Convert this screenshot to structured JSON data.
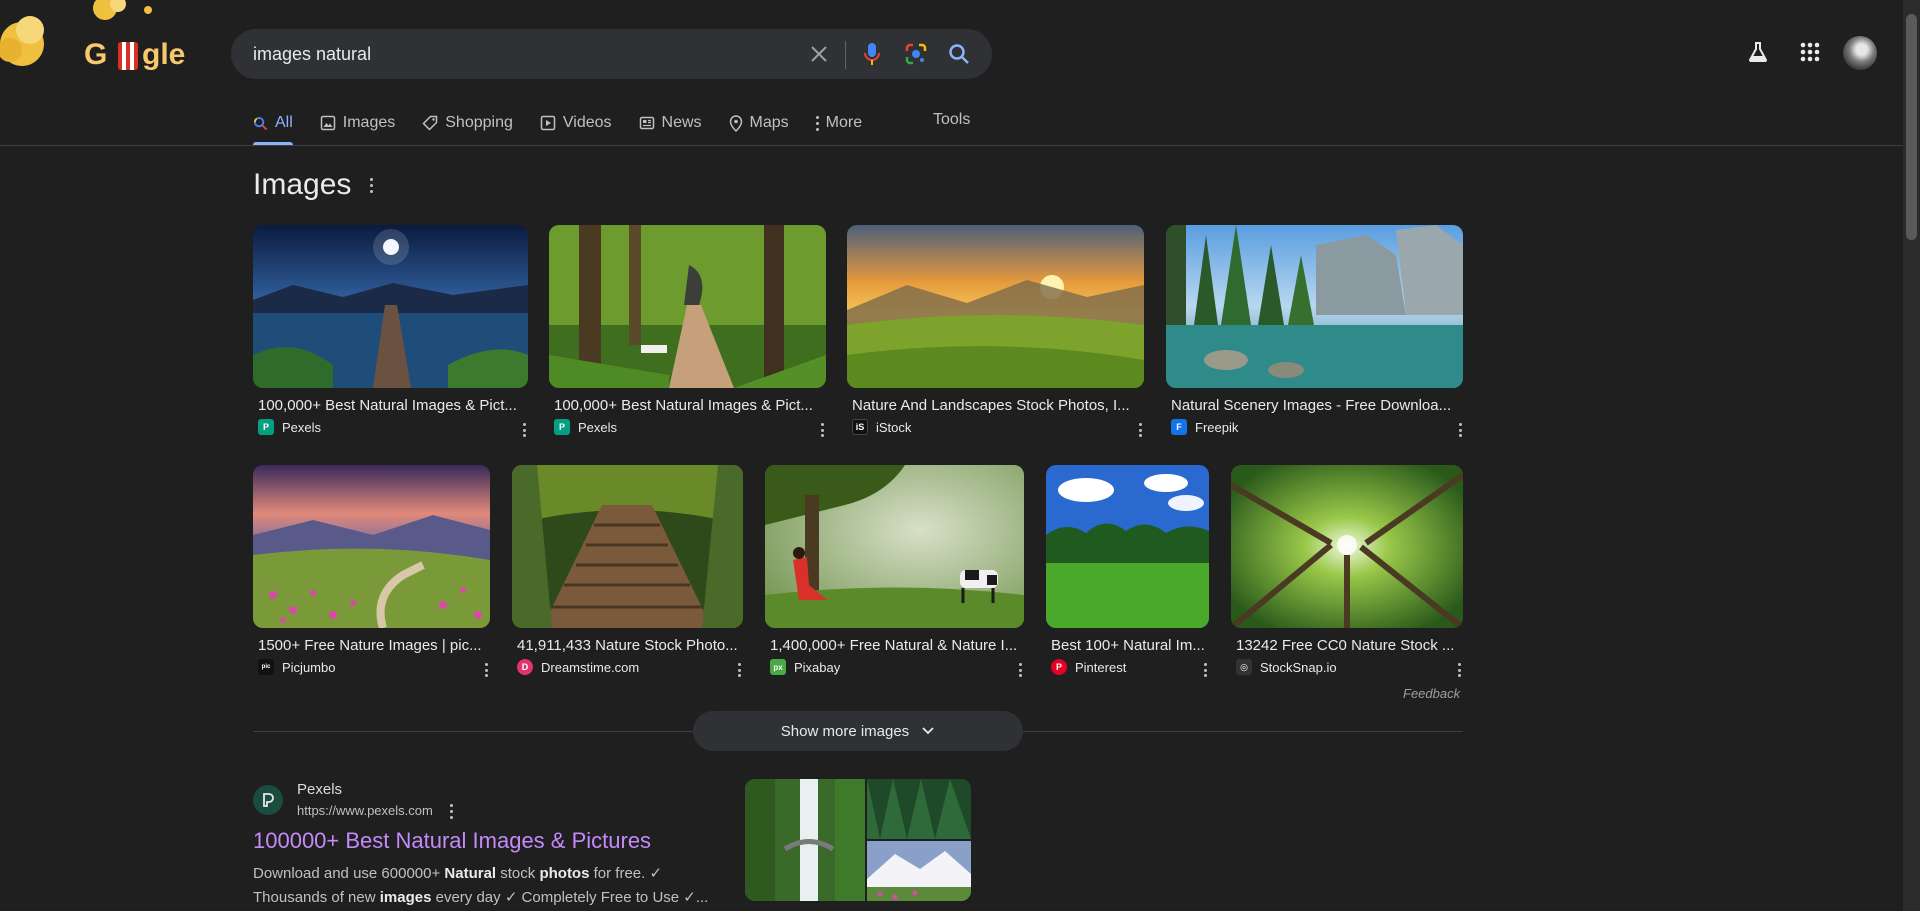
{
  "search": {
    "query": "images natural",
    "logo_text": "Google"
  },
  "tabs": [
    {
      "label": "All",
      "icon": "search-icon",
      "active": true
    },
    {
      "label": "Images",
      "icon": "image-icon"
    },
    {
      "label": "Shopping",
      "icon": "tag-icon"
    },
    {
      "label": "Videos",
      "icon": "play-icon"
    },
    {
      "label": "News",
      "icon": "news-icon"
    },
    {
      "label": "Maps",
      "icon": "map-pin-icon"
    },
    {
      "label": "More",
      "icon": "more-vert-icon"
    }
  ],
  "tools_label": "Tools",
  "images_section": {
    "title": "Images",
    "feedback": "Feedback",
    "show_more": "Show more images",
    "row1": [
      {
        "title": "100,000+ Best Natural Images & Pict...",
        "source": "Pexels",
        "fav_color": "#05a081",
        "fav_text": "P"
      },
      {
        "title": "100,000+ Best Natural Images & Pict...",
        "source": "Pexels",
        "fav_color": "#05a081",
        "fav_text": "P"
      },
      {
        "title": "Nature And Landscapes Stock Photos, I...",
        "source": "iStock",
        "fav_color": "#111111",
        "fav_text": "iS"
      },
      {
        "title": "Natural Scenery Images - Free Downloa...",
        "source": "Freepik",
        "fav_color": "#1273eb",
        "fav_text": "F"
      }
    ],
    "row2": [
      {
        "title": "1500+ Free Nature Images | pic...",
        "source": "Picjumbo",
        "fav_color": "#111111",
        "fav_text": "pic"
      },
      {
        "title": "41,911,433 Nature Stock Photo...",
        "source": "Dreamstime.com",
        "fav_color": "#e3336b",
        "fav_text": "D"
      },
      {
        "title": "1,400,000+ Free Natural & Nature I...",
        "source": "Pixabay",
        "fav_color": "#48a947",
        "fav_text": "px"
      },
      {
        "title": "Best 100+ Natural Im...",
        "source": "Pinterest",
        "fav_color": "#e60023",
        "fav_text": "P"
      },
      {
        "title": "13242 Free CC0 Nature Stock ...",
        "source": "StockSnap.io",
        "fav_color": "#333333",
        "fav_text": "◎"
      }
    ]
  },
  "result": {
    "site": "Pexels",
    "url": "https://www.pexels.com",
    "title": "100000+ Best Natural Images & Pictures",
    "snippet_line1_a": "Download and use 600000+ ",
    "snippet_line1_b": "Natural",
    "snippet_line1_c": " stock ",
    "snippet_line1_d": "photos",
    "snippet_line1_e": " for free. ✓",
    "snippet_line2_a": "Thousands of new ",
    "snippet_line2_b": "images",
    "snippet_line2_c": " every day ✓ Completely Free to Use ✓..."
  }
}
